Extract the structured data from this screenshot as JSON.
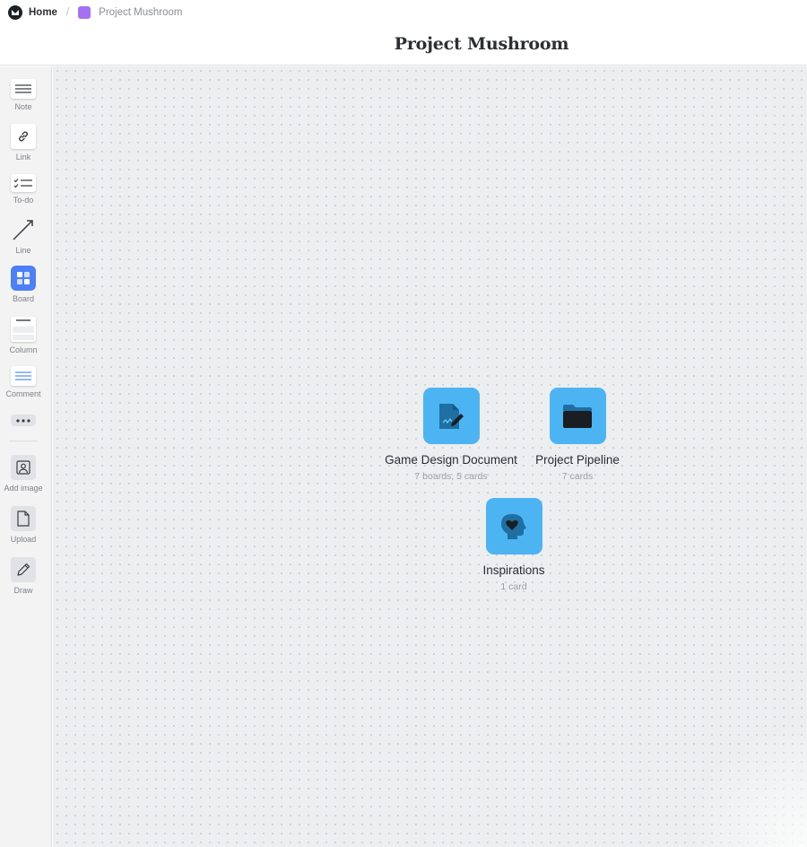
{
  "breadcrumb": {
    "home_label": "Home",
    "current_label": "Project Mushroom",
    "current_color": "#a570f2"
  },
  "page_title": "Project Mushroom",
  "sidebar": {
    "tools": [
      {
        "label": "Note",
        "icon": "note-icon"
      },
      {
        "label": "Link",
        "icon": "link-icon"
      },
      {
        "label": "To-do",
        "icon": "todo-icon"
      },
      {
        "label": "Line",
        "icon": "line-arrow-icon"
      },
      {
        "label": "Board",
        "icon": "board-icon"
      },
      {
        "label": "Column",
        "icon": "column-icon"
      },
      {
        "label": "Comment",
        "icon": "comment-icon"
      },
      {
        "label": "",
        "icon": "more-icon"
      },
      {
        "label": "Add image",
        "icon": "image-icon"
      },
      {
        "label": "Upload",
        "icon": "file-icon"
      },
      {
        "label": "Draw",
        "icon": "pencil-icon"
      }
    ]
  },
  "boards": [
    {
      "name": "Game Design Document",
      "meta": "7 boards, 5 cards",
      "icon": "document-signature-icon"
    },
    {
      "name": "Project Pipeline",
      "meta": "7 cards",
      "icon": "folder-icon"
    },
    {
      "name": "Inspirations",
      "meta": "1 card",
      "icon": "head-heart-icon"
    }
  ],
  "colors": {
    "accent_tile": "#4db4f4",
    "board_tool": "#4d7ff5",
    "canvas": "#eceeef"
  }
}
